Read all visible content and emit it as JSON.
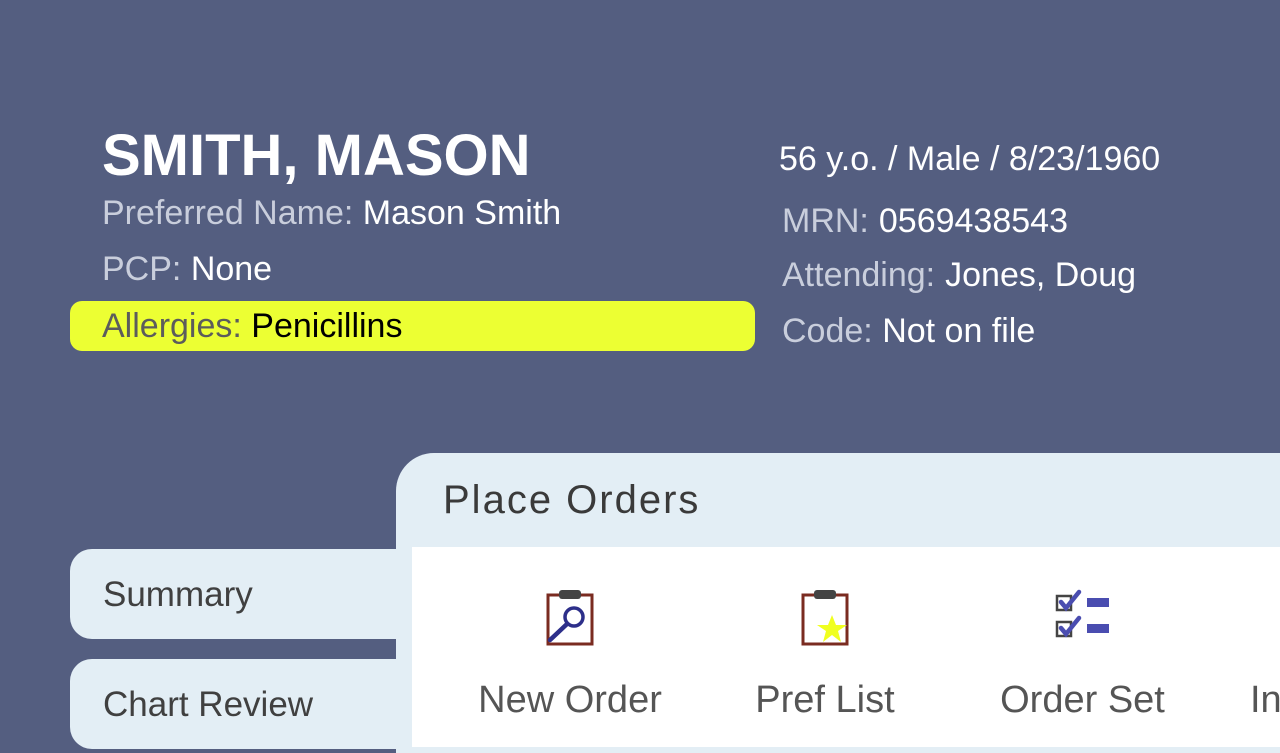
{
  "patient": {
    "name": "SMITH, MASON",
    "preferred_label": "Preferred Name:",
    "preferred_value": "Mason Smith",
    "pcp_label": "PCP:",
    "pcp_value": "None",
    "allergies_label": "Allergies:",
    "allergies_value": "Penicillins",
    "demographics": "56 y.o. / Male / 8/23/1960",
    "mrn_label": "MRN:",
    "mrn_value": "0569438543",
    "attending_label": "Attending:",
    "attending_value": "Jones, Doug",
    "code_label": "Code:",
    "code_value": "Not on file"
  },
  "panel": {
    "title": "Place Orders"
  },
  "tabs": [
    {
      "label": "Summary"
    },
    {
      "label": "Chart Review"
    }
  ],
  "actions": [
    {
      "label": "New Order",
      "icon": "clipboard-magnifier-icon"
    },
    {
      "label": "Pref List",
      "icon": "clipboard-star-icon"
    },
    {
      "label": "Order Set",
      "icon": "checklist-icon"
    },
    {
      "label": "In",
      "icon": ""
    }
  ],
  "colors": {
    "background": "#545e80",
    "allergy_highlight": "#ecff33",
    "panel": "#e3eef5",
    "icon_blue": "#4a4db0",
    "icon_star": "#f0ff20"
  }
}
